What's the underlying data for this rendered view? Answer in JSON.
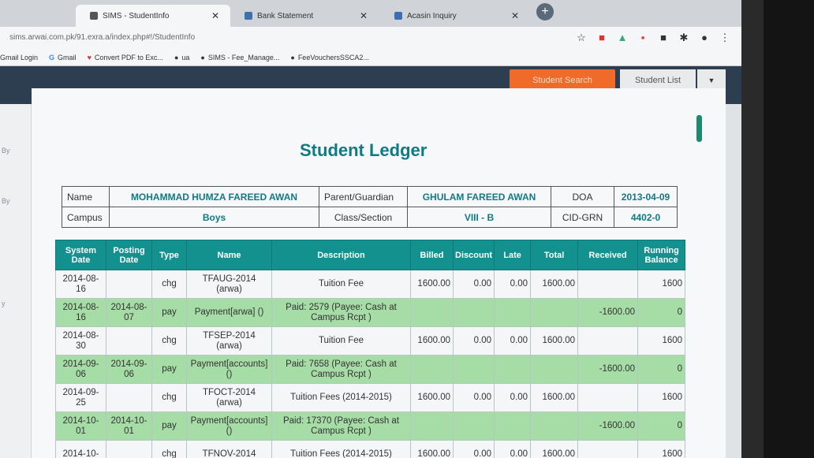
{
  "browser": {
    "tabs": [
      {
        "label": "SIMS - StudentInfo",
        "active": true
      },
      {
        "label": "Bank Statement",
        "active": false
      },
      {
        "label": "Acasin Inquiry",
        "active": false
      }
    ],
    "new_tab_label": "+",
    "url": "sims.arwai.com.pk/91.exra.a/index.php#!/StudentInfo",
    "bookmarks": [
      {
        "icon": "mail-icon",
        "label": "Gmail Login"
      },
      {
        "icon": "google-icon",
        "glyph": "G",
        "label": "Gmail"
      },
      {
        "icon": "pdf-icon",
        "glyph": "♥",
        "label": "Convert PDF to Exc..."
      },
      {
        "icon": "globe-icon",
        "glyph": "●",
        "label": "ua"
      },
      {
        "icon": "globe-icon",
        "glyph": "●",
        "label": "SIMS - Fee_Manage..."
      },
      {
        "icon": "globe-icon",
        "glyph": "●",
        "label": "FeeVouchersSSCA2..."
      }
    ],
    "toolbar_glyphs": [
      "☆",
      "■",
      "▲",
      "▪",
      "■",
      "✱",
      "●",
      "⋮"
    ]
  },
  "header": {
    "student_search_label": "Student Search",
    "student_list_label": "Student List",
    "caret_glyph": "▼"
  },
  "sidebar": {
    "labels": [
      "By",
      "By",
      "y"
    ]
  },
  "page": {
    "title": "Student Ledger"
  },
  "student": {
    "name_label": "Name",
    "name": "MOHAMMAD HUMZA FAREED AWAN",
    "guardian_label": "Parent/Guardian",
    "guardian": "GHULAM FAREED AWAN",
    "doa_label": "DOA",
    "doa": "2013-04-09",
    "campus_label": "Campus",
    "campus": "Boys",
    "class_label": "Class/Section",
    "class": "VIII - B",
    "cid_label": "CID-GRN",
    "cid": "4402-0"
  },
  "ledger": {
    "headers": [
      "System Date",
      "Posting Date",
      "Type",
      "Name",
      "Description",
      "Billed",
      "Discount",
      "Late",
      "Total",
      "Received",
      "Running Balance"
    ],
    "rows": [
      {
        "kind": "chg",
        "system_date": "2014-08-16",
        "posting_date": "",
        "type": "chg",
        "name": "TFAUG-2014 (arwa)",
        "description": "Tuition Fee",
        "billed": "1600.00",
        "discount": "0.00",
        "late": "0.00",
        "total": "1600.00",
        "received": "",
        "balance": "1600"
      },
      {
        "kind": "pay",
        "system_date": "2014-08-16",
        "posting_date": "2014-08-07",
        "type": "pay",
        "name": "Payment[arwa] ()",
        "description": "Paid: 2579 (Payee: Cash at Campus Rcpt )",
        "billed": "",
        "discount": "",
        "late": "",
        "total": "",
        "received": "-1600.00",
        "balance": "0"
      },
      {
        "kind": "chg",
        "system_date": "2014-08-30",
        "posting_date": "",
        "type": "chg",
        "name": "TFSEP-2014 (arwa)",
        "description": "Tuition Fee",
        "billed": "1600.00",
        "discount": "0.00",
        "late": "0.00",
        "total": "1600.00",
        "received": "",
        "balance": "1600"
      },
      {
        "kind": "pay",
        "system_date": "2014-09-06",
        "posting_date": "2014-09-06",
        "type": "pay",
        "name": "Payment[accounts] ()",
        "description": "Paid: 7658 (Payee: Cash at Campus Rcpt )",
        "billed": "",
        "discount": "",
        "late": "",
        "total": "",
        "received": "-1600.00",
        "balance": "0"
      },
      {
        "kind": "chg",
        "system_date": "2014-09-25",
        "posting_date": "",
        "type": "chg",
        "name": "TFOCT-2014 (arwa)",
        "description": "Tuition Fees (2014-2015)",
        "billed": "1600.00",
        "discount": "0.00",
        "late": "0.00",
        "total": "1600.00",
        "received": "",
        "balance": "1600"
      },
      {
        "kind": "pay",
        "system_date": "2014-10-01",
        "posting_date": "2014-10-01",
        "type": "pay",
        "name": "Payment[accounts] ()",
        "description": "Paid: 17370 (Payee: Cash at Campus Rcpt )",
        "billed": "",
        "discount": "",
        "late": "",
        "total": "",
        "received": "-1600.00",
        "balance": "0"
      },
      {
        "kind": "chg",
        "system_date": "2014-10-",
        "posting_date": "",
        "type": "chg",
        "name": "TFNOV-2014",
        "description": "Tuition Fees (2014-2015)",
        "billed": "1600.00",
        "discount": "0.00",
        "late": "0.00",
        "total": "1600.00",
        "received": "",
        "balance": "1600"
      }
    ]
  },
  "colors": {
    "accent": "#12918f",
    "title": "#0f7a86",
    "pay_row": "#a6dca6",
    "orange_button": "#f06b2a"
  }
}
